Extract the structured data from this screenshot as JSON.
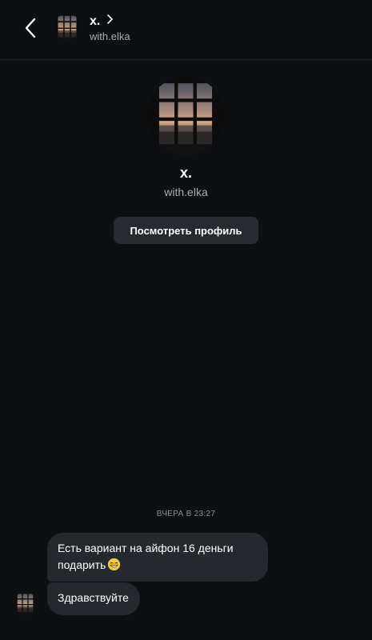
{
  "header": {
    "back_icon": "chevron-left-icon",
    "name": "x.",
    "chevron_icon": "chevron-right-icon",
    "username": "with.elka"
  },
  "profile": {
    "name": "x.",
    "username": "with.elka",
    "view_profile_label": "Посмотреть профиль"
  },
  "conversation": {
    "timestamp": "ВЧЕРА В 23:27",
    "messages": [
      {
        "text": "Есть вариант на айфон 16 деньги подарить",
        "emoji": "grinning-sweat-emoji"
      },
      {
        "text": "Здравствуйте"
      }
    ]
  },
  "colors": {
    "background": "#0c0f14",
    "bubble": "#25282e",
    "button": "#262a31",
    "secondary_text": "#a8adb5"
  }
}
